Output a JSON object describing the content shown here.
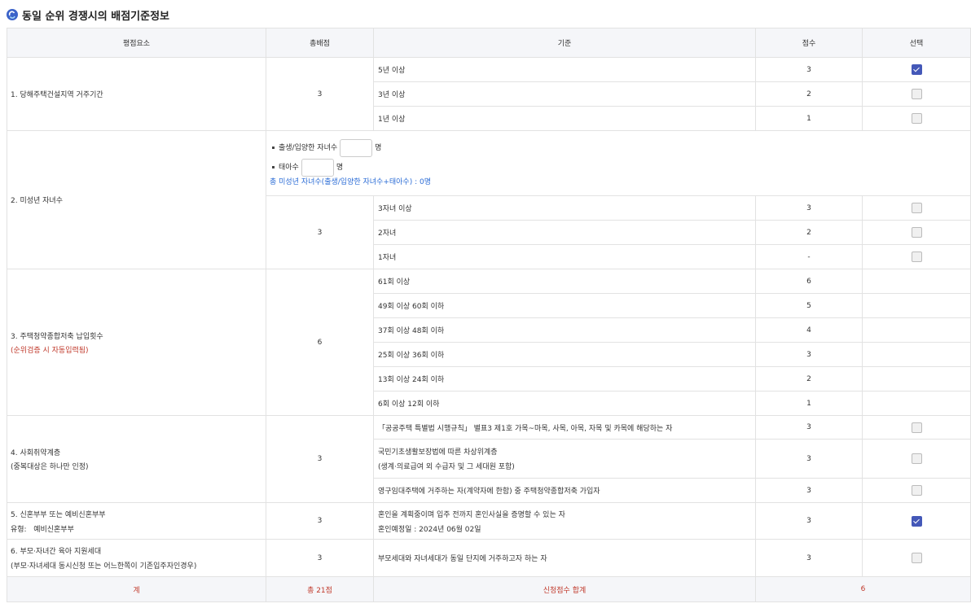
{
  "title": "동일 순위 경쟁시의 배점기준정보",
  "headers": [
    "평점요소",
    "총배점",
    "기준",
    "점수",
    "선택"
  ],
  "r1": {
    "label": "1. 당해주택건설지역 거주기간",
    "total": "3",
    "items": [
      {
        "crit": "5년 이상",
        "score": "3",
        "checked": true
      },
      {
        "crit": "3년 이상",
        "score": "2",
        "checked": false
      },
      {
        "crit": "1년 이상",
        "score": "1",
        "checked": false
      }
    ]
  },
  "r2": {
    "label": "2. 미성년 자녀수",
    "total": "3",
    "input1_label": "출생/입양한 자녀수",
    "input1_unit": "명",
    "input2_label": "태아수",
    "input2_unit": "명",
    "sum_text": "총 미성년 자녀수(출생/입양한 자녀수+태아수) : 0명",
    "items": [
      {
        "crit": "3자녀 이상",
        "score": "3",
        "checked": false
      },
      {
        "crit": "2자녀",
        "score": "2",
        "checked": false
      },
      {
        "crit": "1자녀",
        "score": "-",
        "checked": false
      }
    ]
  },
  "r3": {
    "label": "3. 주택청약종합저축 납입횟수",
    "note": "(순위검증 시 자동입력됨)",
    "total": "6",
    "items": [
      {
        "crit": "61회 이상",
        "score": "6"
      },
      {
        "crit": "49회 이상 60회 이하",
        "score": "5"
      },
      {
        "crit": "37회 이상 48회 이하",
        "score": "4"
      },
      {
        "crit": "25회 이상 36회 이하",
        "score": "3"
      },
      {
        "crit": "13회 이상 24회 이하",
        "score": "2"
      },
      {
        "crit": "6회 이상 12회 이하",
        "score": "1"
      }
    ]
  },
  "r4": {
    "label": "4. 사회취약계층",
    "note": "(중복대상은 하나만 인정)",
    "total": "3",
    "items": [
      {
        "crit": "「공공주택 특별법 시행규칙」 별표3 제1호 가목~마목, 사목, 아목, 자목 및 카목에 해당하는 자",
        "crit2": "",
        "score": "3",
        "checked": false
      },
      {
        "crit": "국민기초생활보장법에 따른 차상위계층",
        "crit2": "(생계·의료급여 외 수급자 및 그 세대원 포함)",
        "score": "3",
        "checked": false
      },
      {
        "crit": "영구임대주택에 거주하는 자(계약자에 한함) 중 주택청약종합저축 가입자",
        "crit2": "",
        "score": "3",
        "checked": false
      }
    ]
  },
  "r5": {
    "label": "5. 신혼부부 또는 예비신혼부부",
    "type_label": "유형:",
    "type_value": "예비신혼부부",
    "total": "3",
    "crit": "혼인을 계획중이며 입주 전까지 혼인사실을 증명할 수 있는 자",
    "crit2": "혼인예정일 : 2024년 06월 02일",
    "score": "3",
    "checked": true
  },
  "r6": {
    "label": "6. 부모·자녀간 육아 지원세대",
    "note": "(부모·자녀세대 동시신청 또는 어느한쪽이 기존입주자인경우)",
    "total": "3",
    "crit": "부모세대와 자녀세대가 동일 단지에 거주하고자 하는 자",
    "score": "3",
    "checked": false
  },
  "footer": {
    "label": "계",
    "total": "총 21점",
    "sum_label": "신청점수 합계",
    "sum_value": "6"
  },
  "colors": {
    "accent": "#4458b8",
    "red": "#c0392b",
    "blue": "#2b6cd6"
  }
}
